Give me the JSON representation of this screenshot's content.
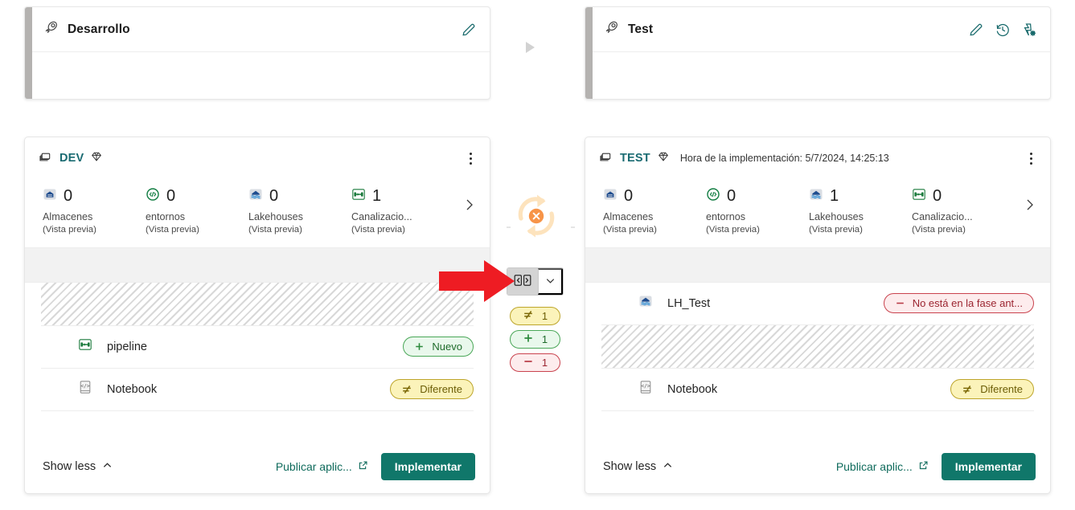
{
  "stages": [
    {
      "name": "Desarrollo",
      "icon": "rocket-icon",
      "actions": [
        "edit-pencil-icon"
      ]
    },
    {
      "name": "Test",
      "icon": "rocket-icon",
      "actions": [
        "edit-pencil-icon",
        "deployment-history-icon",
        "stage-settings-icon"
      ]
    }
  ],
  "cards": [
    {
      "stage_label": "DEV",
      "workspace_icon": "workspace-icon",
      "capacity_icon": "diamond-capacity-icon",
      "deploy_time": "",
      "metrics": [
        {
          "icon": "warehouse-icon",
          "count": "0",
          "label": "Almacenes",
          "sub": "(Vista previa)"
        },
        {
          "icon": "environment-icon",
          "count": "0",
          "label": "entornos",
          "sub": "(Vista previa)"
        },
        {
          "icon": "lakehouse-icon",
          "count": "0",
          "label": "Lakehouses",
          "sub": "(Vista previa)"
        },
        {
          "icon": "pipeline-icon",
          "count": "1",
          "label": "Canalizacio...",
          "sub": "(Vista previa)"
        }
      ],
      "rows": [
        {
          "kind": "striped"
        },
        {
          "kind": "item",
          "icon": "pipeline-icon",
          "name": "pipeline",
          "badge": {
            "text": "Nuevo",
            "style": "new",
            "glyph": "plus"
          }
        },
        {
          "kind": "item",
          "icon": "notebook-icon",
          "name": "Notebook",
          "badge": {
            "text": "Diferente",
            "style": "diff",
            "glyph": "not-equal"
          }
        }
      ],
      "footer": {
        "show_less": "Show less",
        "publish": "Publicar aplic...",
        "deploy": "Implementar"
      }
    },
    {
      "stage_label": "TEST",
      "workspace_icon": "workspace-icon",
      "capacity_icon": "diamond-capacity-icon",
      "deploy_time": "Hora de la implementación: 5/7/2024, 14:25:13",
      "metrics": [
        {
          "icon": "warehouse-icon",
          "count": "0",
          "label": "Almacenes",
          "sub": "(Vista previa)"
        },
        {
          "icon": "environment-icon",
          "count": "0",
          "label": "entornos",
          "sub": "(Vista previa)"
        },
        {
          "icon": "lakehouse-icon",
          "count": "1",
          "label": "Lakehouses",
          "sub": "(Vista previa)"
        },
        {
          "icon": "pipeline-icon",
          "count": "0",
          "label": "Canalizacio...",
          "sub": "(Vista previa)"
        }
      ],
      "rows": [
        {
          "kind": "item",
          "icon": "lakehouse-icon",
          "name": "LH_Test",
          "badge": {
            "text": "No está en la fase ant...",
            "style": "missing",
            "glyph": "minus"
          }
        },
        {
          "kind": "striped"
        },
        {
          "kind": "item",
          "icon": "notebook-icon",
          "name": "Notebook",
          "badge": {
            "text": "Diferente",
            "style": "diff",
            "glyph": "not-equal"
          }
        }
      ],
      "footer": {
        "show_less": "Show less",
        "publish": "Publicar aplic...",
        "deploy": "Implementar"
      }
    }
  ],
  "gutter": {
    "sync_status_icon": "sync-failed-icon",
    "compare_button_icon": "compare-side-by-side-icon",
    "compare_caret_icon": "chevron-down-icon",
    "diff_badges": [
      {
        "glyph": "not-equal",
        "count": "1",
        "style": "diff"
      },
      {
        "glyph": "plus",
        "count": "1",
        "style": "new"
      },
      {
        "glyph": "minus",
        "count": "1",
        "style": "missing"
      }
    ]
  },
  "annotation": {
    "pointer": "red-arrow-annotation"
  },
  "colors": {
    "accent_teal": "#10776a",
    "stage_name": "#1a6b72",
    "new": "#4aa758",
    "diff": "#bda52c",
    "missing": "#c9434e",
    "sync_orange": "#f59b42",
    "stage_bar": "#b4b2b0"
  }
}
